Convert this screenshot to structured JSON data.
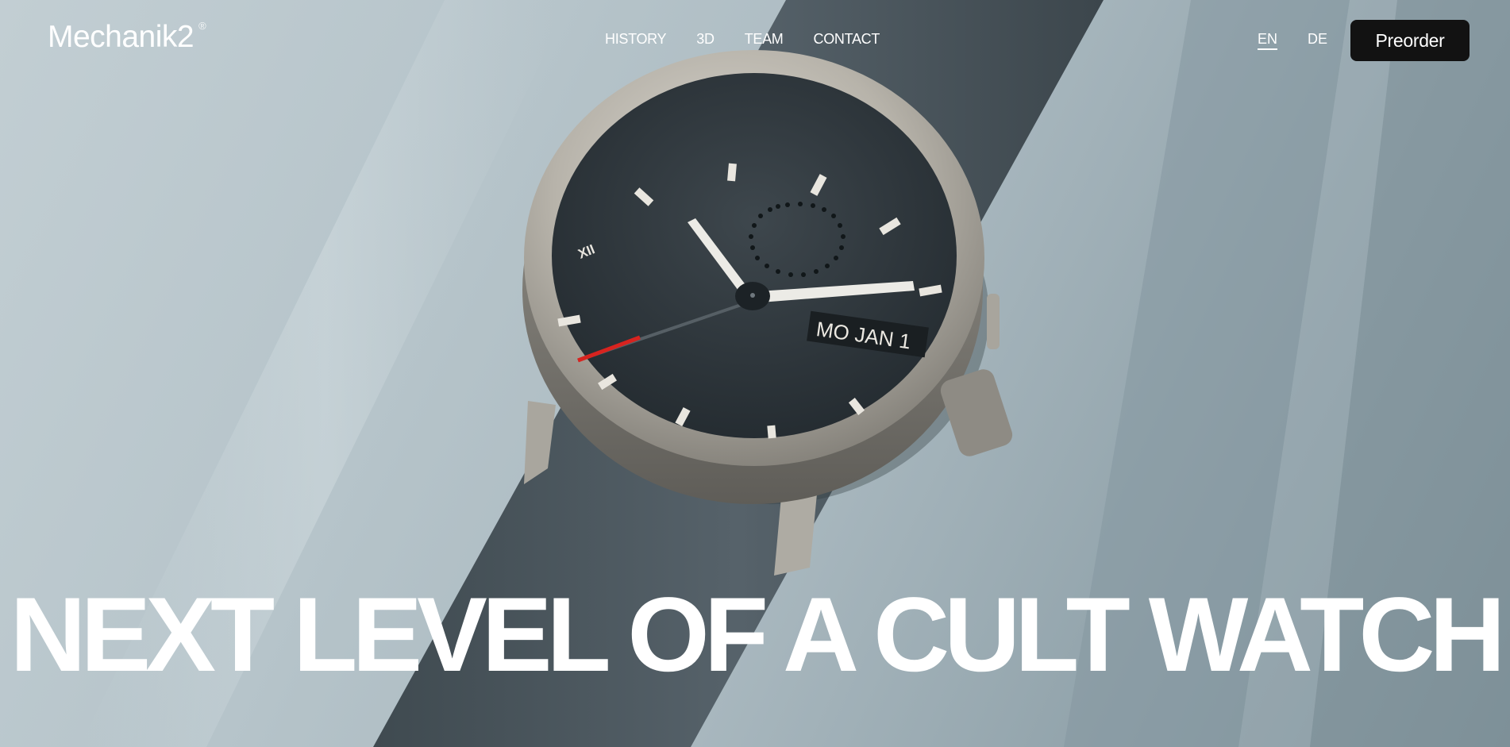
{
  "brand": {
    "name": "Mechanik2",
    "mark": "®"
  },
  "nav": {
    "items": [
      {
        "label": "HISTORY"
      },
      {
        "label": "3D"
      },
      {
        "label": "TEAM"
      },
      {
        "label": "CONTACT"
      }
    ]
  },
  "language": {
    "options": [
      "EN",
      "DE"
    ],
    "selected": "EN"
  },
  "cta": {
    "preorder_label": "Preorder"
  },
  "hero": {
    "headline": "NEXT LEVEL OF A CULT WATCH",
    "watch": {
      "date_window": "MO JAN 1",
      "numeral": "XII"
    }
  },
  "colors": {
    "background": "#b9c6cc",
    "strap": "#4b565c",
    "case": "#b8b5ae",
    "dial": "#2f373c",
    "seconds_hand_tip": "#d8231f",
    "cta_background": "#121212",
    "text": "#ffffff"
  }
}
